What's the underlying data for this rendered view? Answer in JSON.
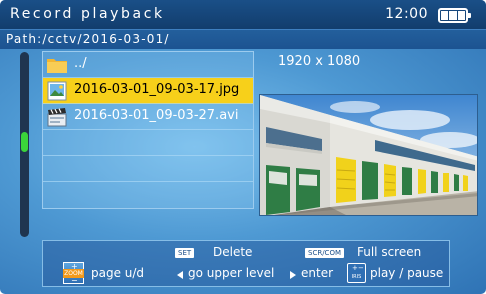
{
  "header": {
    "title": "Record playback",
    "time": "12:00",
    "battery_icon": "battery-full-icon"
  },
  "path": {
    "label": "Path:/cctv/2016-03-01/"
  },
  "files": [
    {
      "name": "../",
      "icon": "folder-icon",
      "selected": false
    },
    {
      "name": "2016-03-01_09-03-17.jpg",
      "icon": "image-file-icon",
      "selected": true
    },
    {
      "name": "2016-03-01_09-03-27.avi",
      "icon": "video-file-icon",
      "selected": false
    }
  ],
  "preview": {
    "resolution": "1920 x 1080"
  },
  "help": {
    "set_key": "SET",
    "delete_label": "Delete",
    "scrcom_key": "SCR/COM",
    "fullscreen_label": "Full screen",
    "zoom_key": "ZOOM",
    "page_label": "page u/d",
    "upper_label": "go upper level",
    "enter_label": "enter",
    "iris_key": "IRIS",
    "play_label": "play / pause"
  },
  "colors": {
    "selection": "#f7d01a",
    "scroll_thumb": "#3bd43b",
    "title_bar": "#1a4f87"
  }
}
